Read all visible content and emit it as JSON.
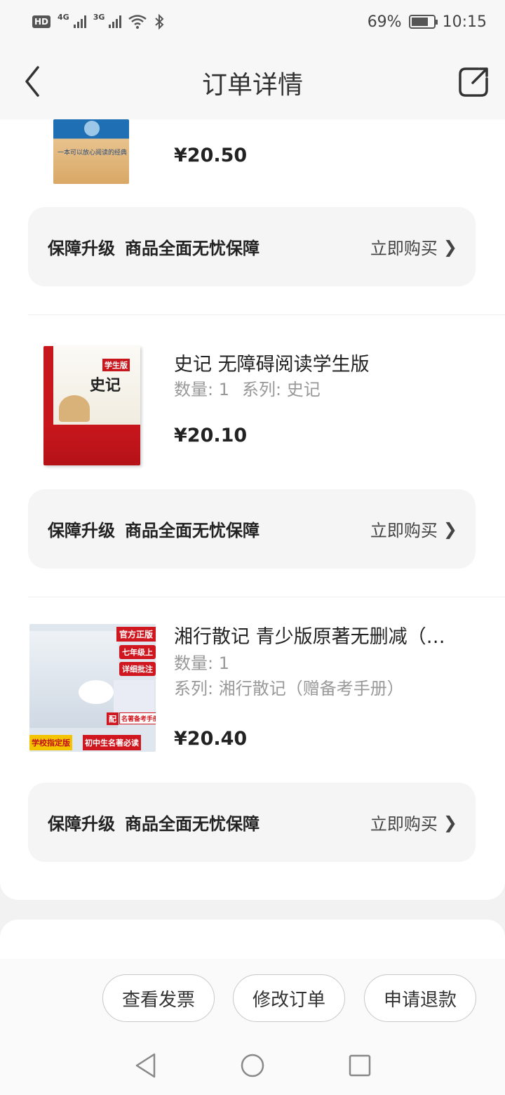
{
  "status_bar": {
    "hd": "HD",
    "net1": "4G",
    "net2": "3G",
    "battery": "69%",
    "battery_level": 0.69,
    "time": "10:15"
  },
  "header": {
    "title": "订单详情"
  },
  "products": [
    {
      "title": "",
      "quantity": "",
      "series": "",
      "price": "¥20.50",
      "cover_text": "一本可以放心阅读的经典"
    },
    {
      "title": "史记 无障碍阅读学生版",
      "quantity": "数量: 1",
      "series": "系列: 史记",
      "price": "¥20.10",
      "cover_title": "史记",
      "cover_badge": "学生版"
    },
    {
      "title": "湘行散记 青少版原著无删减（…",
      "quantity": "数量: 1",
      "series": "系列: 湘行散记（赠备考手册）",
      "price": "¥20.40",
      "cover_tag1": "官方正版",
      "cover_tag2": "七年级上",
      "cover_tag3": "详细批注",
      "cover_tag4": "学校指定版",
      "cover_tag5": "初中生名著必读",
      "cover_tag6": "名著备考手册",
      "cover_tag7": "配"
    }
  ],
  "guarantee": {
    "label": "保障升级",
    "desc": "商品全面无忧保障",
    "buy": "立即购买",
    "chevron": "❯"
  },
  "actions": {
    "invoice": "查看发票",
    "modify": "修改订单",
    "refund": "申请退款"
  },
  "icons": {
    "back": "chevron-left-icon",
    "share": "share-icon",
    "nav_back": "triangle-back-icon",
    "nav_home": "circle-home-icon",
    "nav_recent": "square-recent-icon"
  }
}
